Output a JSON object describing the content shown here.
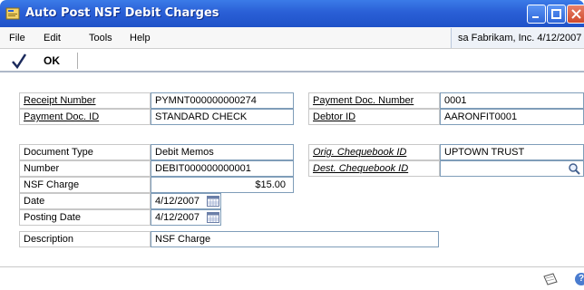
{
  "window": {
    "title": "Auto Post NSF Debit Charges"
  },
  "menu": {
    "items": [
      "File",
      "Edit",
      "Tools",
      "Help"
    ]
  },
  "userinfo": "sa  Fabrikam, Inc.  4/12/2007",
  "toolbar": {
    "ok_label": "OK"
  },
  "fields": {
    "receipt_number": {
      "label": "Receipt Number",
      "value": "PYMNT000000000274"
    },
    "payment_doc_id": {
      "label": "Payment Doc. ID",
      "value": "STANDARD CHECK"
    },
    "payment_doc_number": {
      "label": "Payment Doc. Number",
      "value": "0001"
    },
    "debtor_id": {
      "label": "Debtor ID",
      "value": "AARONFIT0001"
    },
    "document_type": {
      "label": "Document Type",
      "value": "Debit Memos"
    },
    "number": {
      "label": "Number",
      "value": "DEBIT000000000001"
    },
    "nsf_charge": {
      "label": "NSF Charge",
      "value": "$15.00"
    },
    "date": {
      "label": "Date",
      "value": "4/12/2007"
    },
    "posting_date": {
      "label": "Posting Date",
      "value": "4/12/2007"
    },
    "description": {
      "label": "Description",
      "value": "NSF Charge"
    },
    "orig_chequebook_id": {
      "label": "Orig. Chequebook ID",
      "value": "UPTOWN TRUST"
    },
    "dest_chequebook_id": {
      "label": "Dest. Chequebook ID",
      "value": ""
    }
  },
  "icons": {
    "window": "app-window-icon",
    "ok": "checkmark-icon",
    "calendar": "calendar-icon",
    "lookup": "magnifier-icon",
    "note": "note-icon",
    "help": "help-icon"
  },
  "colors": {
    "titlebar": "#2a5fd6",
    "field_border": "#7f9db9"
  }
}
